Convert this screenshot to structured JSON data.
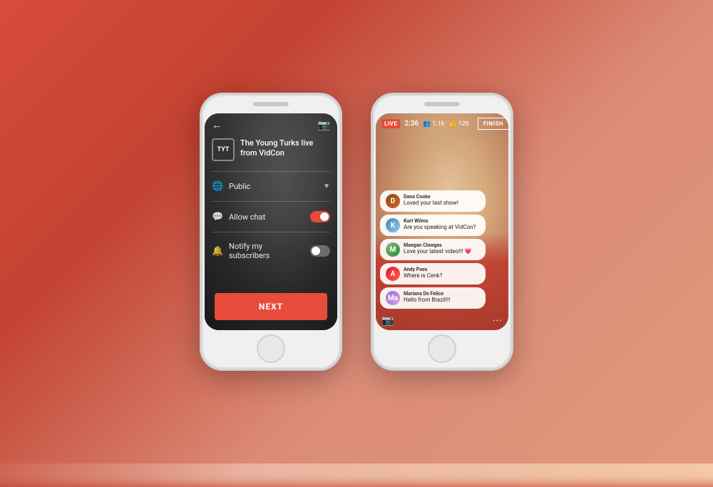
{
  "background": {
    "description": "blurred red gradient background"
  },
  "phone1": {
    "topbar": {
      "back_icon": "←",
      "camera_icon": "📷"
    },
    "channel": {
      "logo": "TYT",
      "title": "The Young Turks live from VidCon"
    },
    "options": [
      {
        "icon": "🌐",
        "label": "Public",
        "has_chevron": true,
        "chevron": "▼",
        "has_toggle": false
      },
      {
        "icon": "💬",
        "label": "Allow chat",
        "has_chevron": false,
        "has_toggle": true,
        "toggle_on": true
      },
      {
        "icon": "🔔",
        "label": "Notify my subscribers",
        "has_chevron": false,
        "has_toggle": true,
        "toggle_on": false
      }
    ],
    "next_button": "NEXT"
  },
  "phone2": {
    "topbar": {
      "live_label": "LIVE",
      "time": "2:36",
      "viewers": "1.1k",
      "likes": "126",
      "finish_button": "FINISH"
    },
    "chat_messages": [
      {
        "username": "Dana Cooke",
        "text": "Loved your last show!",
        "avatar_initial": "D",
        "avatar_class": "av1"
      },
      {
        "username": "Kurt Wilms",
        "text": "Are you speaking at VidCon?",
        "avatar_initial": "K",
        "avatar_class": "av2"
      },
      {
        "username": "Maegan Clawges",
        "text": "Love your latest video!!! 💗",
        "avatar_initial": "M",
        "avatar_class": "av3"
      },
      {
        "username": "Andy Poes",
        "text": "Where is Cenk?",
        "avatar_initial": "A",
        "avatar_class": "av4"
      },
      {
        "username": "Mariana De Felice",
        "text": "Hello from Brazil!!!",
        "avatar_initial": "Ma",
        "avatar_class": "av5"
      }
    ],
    "bottombar": {
      "camera_icon": "📷",
      "more_icon": "···"
    }
  }
}
